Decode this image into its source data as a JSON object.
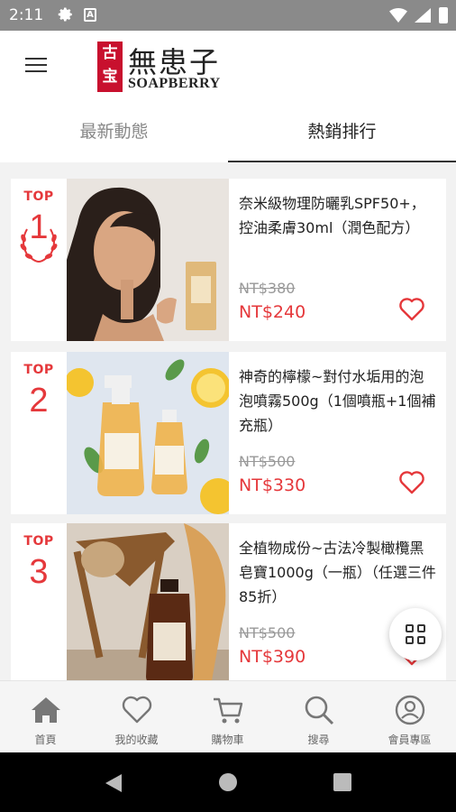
{
  "status": {
    "time": "2:11",
    "a_icon": "A"
  },
  "brand": {
    "seal": "古宝",
    "name_cn": "無患子",
    "name_en": "SOAPBERRY"
  },
  "tabs": [
    {
      "label": "最新動態",
      "active": false
    },
    {
      "label": "熱銷排行",
      "active": true
    }
  ],
  "products": [
    {
      "top": "TOP",
      "rank": "1",
      "title": "奈米級物理防曬乳SPF50+，控油柔膚30ml（潤色配方）",
      "old_price": "NT$380",
      "price": "NT$240"
    },
    {
      "top": "TOP",
      "rank": "2",
      "title": "神奇的檸檬~對付水垢用的泡泡噴霧500g（1個噴瓶+1個補充瓶）",
      "old_price": "NT$500",
      "price": "NT$330"
    },
    {
      "top": "TOP",
      "rank": "3",
      "title": "全植物成份~古法冷製橄欖黑皂寶1000g（一瓶）（任選三件85折）",
      "old_price": "NT$500",
      "price": "NT$390"
    }
  ],
  "nav": [
    {
      "label": "首頁",
      "icon": "home-icon"
    },
    {
      "label": "我的收藏",
      "icon": "heart-icon"
    },
    {
      "label": "購物車",
      "icon": "cart-icon"
    },
    {
      "label": "搜尋",
      "icon": "search-icon"
    },
    {
      "label": "會員專區",
      "icon": "user-icon"
    }
  ],
  "colors": {
    "accent": "#e5383b",
    "statusbar": "#8a8a8a"
  }
}
